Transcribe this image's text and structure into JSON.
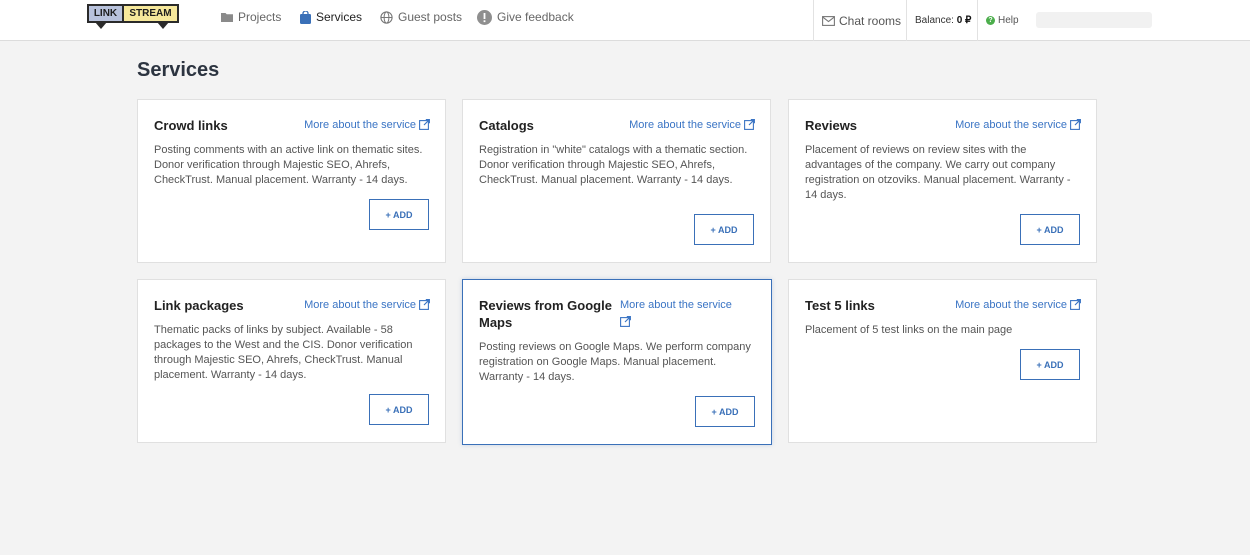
{
  "logo": {
    "left": "LINK",
    "right": "STREAM"
  },
  "nav": {
    "projects": "Projects",
    "services": "Services",
    "guest_posts": "Guest posts",
    "feedback": "Give feedback"
  },
  "header": {
    "chat_rooms": "Chat rooms",
    "balance_label": "Balance:",
    "balance_value": "0 ₽",
    "help": "Help"
  },
  "page_title": "Services",
  "more_label": "More about the service",
  "add_label": "+ ADD",
  "cards": [
    {
      "title": "Crowd links",
      "desc": "Posting comments with an active link on thematic sites. Donor verification through Majestic SEO, Ahrefs, CheckTrust. Manual placement. Warranty - 14 days."
    },
    {
      "title": "Catalogs",
      "desc": "Registration in \"white\" catalogs with a thematic section. Donor verification through Majestic SEO, Ahrefs, CheckTrust. Manual placement. Warranty - 14 days."
    },
    {
      "title": "Reviews",
      "desc": "Placement of reviews on review sites with the advantages of the company. We carry out company registration on otzoviks. Manual placement. Warranty - 14 days."
    },
    {
      "title": "Link packages",
      "desc": "Thematic packs of links by subject. Available - 58 packages to the West and the CIS. Donor verification through Majestic SEO, Ahrefs, CheckTrust. Manual placement. Warranty - 14 days."
    },
    {
      "title": "Reviews from Google Maps",
      "desc": "Posting reviews on Google Maps. We perform company registration on Google Maps. Manual placement. Warranty - 14 days."
    },
    {
      "title": "Test 5 links",
      "desc": "Placement of 5 test links on the main page"
    }
  ],
  "colors": {
    "accent": "#3a70b8",
    "link": "#3a74c4",
    "background": "#f3f3f3"
  }
}
